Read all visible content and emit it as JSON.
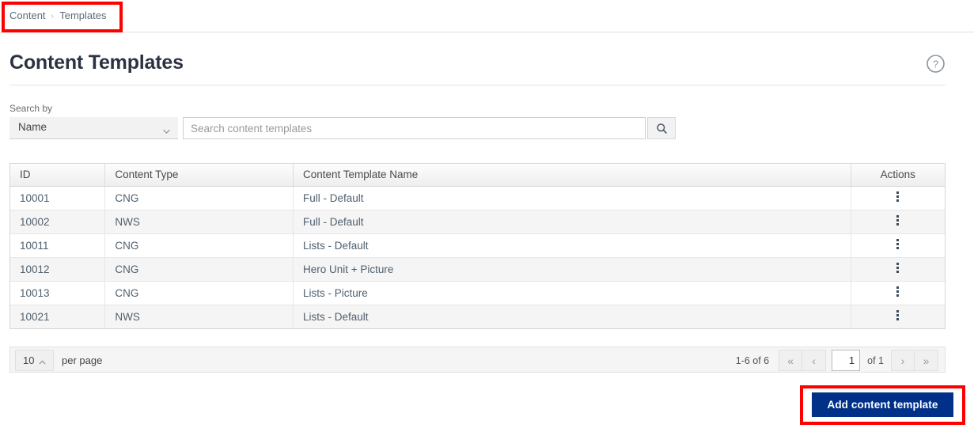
{
  "breadcrumb": {
    "items": [
      {
        "label": "Content",
        "icon": ""
      },
      {
        "label": "Templates",
        "icon": ""
      }
    ],
    "separator": "›"
  },
  "header": {
    "title": "Content Templates",
    "help_icon": "question-circle-icon"
  },
  "search": {
    "label": "Search by",
    "select_value": "Name",
    "select_icon": "chevron-down-icon",
    "input_placeholder": "Search content templates",
    "input_value": "",
    "button_icon": "search-icon"
  },
  "table": {
    "columns": [
      {
        "key": "id",
        "label": "ID"
      },
      {
        "key": "type",
        "label": "Content Type"
      },
      {
        "key": "name",
        "label": "Content Template Name"
      },
      {
        "key": "actions",
        "label": "Actions"
      }
    ],
    "rows": [
      {
        "id": "10001",
        "type": "CNG",
        "name": "Full - Default",
        "actions_icon": "kebab-menu-icon"
      },
      {
        "id": "10002",
        "type": "NWS",
        "name": "Full - Default",
        "actions_icon": "kebab-menu-icon"
      },
      {
        "id": "10011",
        "type": "CNG",
        "name": "Lists - Default",
        "actions_icon": "kebab-menu-icon"
      },
      {
        "id": "10012",
        "type": "CNG",
        "name": "Hero Unit + Picture",
        "actions_icon": "kebab-menu-icon"
      },
      {
        "id": "10013",
        "type": "CNG",
        "name": "Lists - Picture",
        "actions_icon": "kebab-menu-icon"
      },
      {
        "id": "10021",
        "type": "NWS",
        "name": "Lists - Default",
        "actions_icon": "kebab-menu-icon"
      }
    ]
  },
  "pagination": {
    "per_page_value": "10",
    "per_page_icon": "chevron-up-icon",
    "per_page_label": "per page",
    "range_text": "1-6 of 6",
    "first_label": "«",
    "prev_label": "‹",
    "page_value": "1",
    "of_text": "of 1",
    "next_label": "›",
    "last_label": "»"
  },
  "footer": {
    "add_button_label": "Add content template"
  },
  "colors": {
    "accent": "#003087",
    "annotation": "#ff0000",
    "breadcrumb_text": "#5a6b7b",
    "title_text": "#2b3340",
    "row_alt": "#f5f5f5"
  }
}
